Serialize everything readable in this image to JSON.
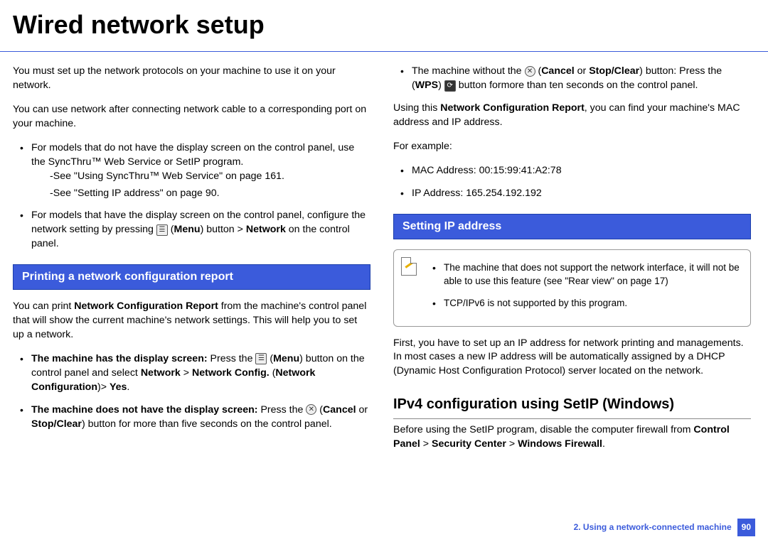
{
  "title": "Wired network setup",
  "left": {
    "intro1": "You must set up the network protocols on your machine to use it on your network.",
    "intro2": "You can use network after connecting network cable to a corresponding port on your machine.",
    "b1": "For models that do not have the display screen on the control panel, use the SyncThru™ Web Service or SetIP program.",
    "b1s1": "-See \"Using SyncThru™ Web Service\" on page 161.",
    "b1s2": "-See \"Setting IP address\" on page 90.",
    "b2p1": "For models that have the display screen on the control panel, configure the network setting by pressing ",
    "b2menu": "Menu",
    "b2p2": ") button > ",
    "b2net": "Network",
    "b2p3": " on the control panel.",
    "sect1": "Printing a network configuration report",
    "p1a": "You can print ",
    "p1b": "Network Configuration Report",
    "p1c": " from the machine's control panel that will show the current machine's network settings. This will help you to set up a network.",
    "l1a": "The machine has the display screen:",
    "l1b": " Press the ",
    "l1menu": "Menu",
    "l1c": ") button on the control panel and select ",
    "l1d": "Network",
    "l1e": " > ",
    "l1f": "Network Config.",
    "l1g": " (",
    "l1h": "Network Configuration",
    "l1i": ")> ",
    "l1j": "Yes",
    "l1k": ".",
    "l2a": "The machine does not have the display screen:",
    "l2b": " Press the ",
    "l2c": "Cancel",
    "l2d": " or ",
    "l2e": "Stop/Clear",
    "l2f": ") button for more than five seconds on the control panel."
  },
  "right": {
    "r1a": "The machine without the ",
    "r1b": "Cancel",
    "r1c": " or ",
    "r1d": "Stop/Clear",
    "r1e": ") button: Press the (",
    "r1f": "WPS",
    "r1g": " button formore than ten seconds on the control panel.",
    "p2a": "Using this ",
    "p2b": "Network Configuration Report",
    "p2c": ", you can find your machine's MAC address and IP address.",
    "ex": "For example:",
    "mac": "MAC Address: 00:15:99:41:A2:78",
    "ip": "IP Address: 165.254.192.192",
    "sect2": "Setting IP address",
    "note1": "The machine that does not support the network interface, it will not be able to use this feature (see \"Rear view\" on page 17)",
    "note2": "TCP/IPv6 is not supported by this program.",
    "p3": "First, you have to set up an IP address for network printing and managements. In most cases a new IP address will be automatically assigned by a DHCP (Dynamic Host Configuration Protocol) server located on the network.",
    "sub": "IPv4 configuration using SetIP (Windows)",
    "p4a": "Before using the SetIP program, disable the computer firewall from ",
    "p4b": "Control Panel",
    "p4c": " > ",
    "p4d": "Security Center",
    "p4e": " > ",
    "p4f": "Windows Firewall",
    "p4g": "."
  },
  "footer": {
    "chap": "2.  Using a network-connected machine",
    "page": "90"
  }
}
